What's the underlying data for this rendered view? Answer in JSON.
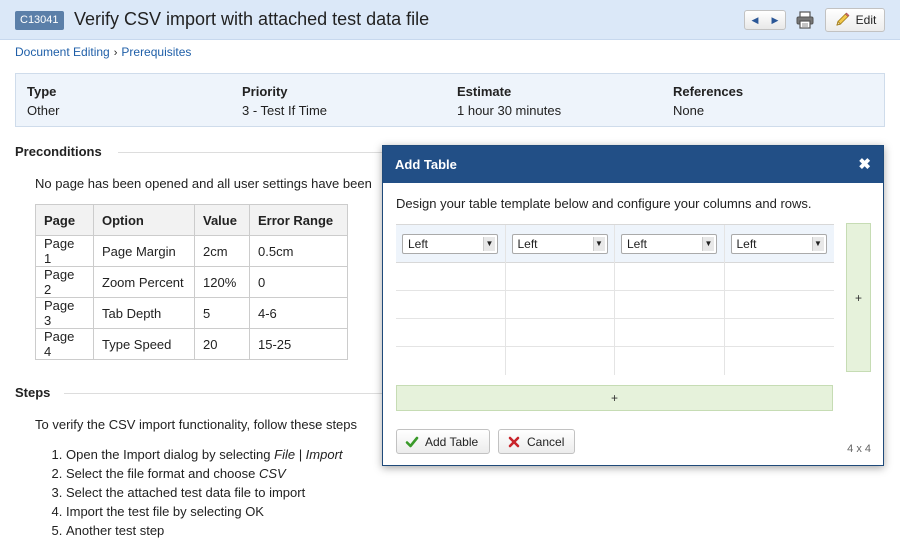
{
  "header": {
    "case_id": "C13041",
    "title": "Verify CSV import with attached test data file",
    "edit_label": "Edit",
    "prev_glyph": "◀",
    "next_glyph": "▶"
  },
  "breadcrumb": {
    "items": [
      "Document Editing",
      "Prerequisites"
    ],
    "separator": "›"
  },
  "info": {
    "fields": [
      {
        "label": "Type",
        "value": "Other"
      },
      {
        "label": "Priority",
        "value": "3 - Test If Time"
      },
      {
        "label": "Estimate",
        "value": "1 hour 30 minutes"
      },
      {
        "label": "References",
        "value": "None"
      }
    ]
  },
  "preconditions": {
    "title": "Preconditions",
    "text": "No page has been opened and all user settings have been",
    "table": {
      "headers": [
        "Page",
        "Option",
        "Value",
        "Error Range"
      ],
      "rows": [
        [
          "Page 1",
          "Page Margin",
          "2cm",
          "0.5cm"
        ],
        [
          "Page 2",
          "Zoom Percent",
          "120%",
          "0"
        ],
        [
          "Page 3",
          "Tab Depth",
          "5",
          "4-6"
        ],
        [
          "Page 4",
          "Type Speed",
          "20",
          "15-25"
        ]
      ]
    }
  },
  "steps": {
    "title": "Steps",
    "intro": "To verify the CSV import functionality, follow these steps",
    "items": [
      {
        "text": "Open the Import dialog by selecting ",
        "em": "File | Import"
      },
      {
        "text": "Select the file format and choose ",
        "em": "CSV"
      },
      {
        "text": "Select the attached test data file to import",
        "em": ""
      },
      {
        "text": "Import the test file by selecting OK",
        "em": ""
      },
      {
        "text": "Another test step",
        "em": ""
      }
    ]
  },
  "dialog": {
    "title": "Add Table",
    "close_glyph": "✖",
    "description": "Design your table template below and configure your columns and rows.",
    "columns": [
      {
        "align": "Left"
      },
      {
        "align": "Left"
      },
      {
        "align": "Left"
      },
      {
        "align": "Left"
      }
    ],
    "add_column_label": "+",
    "add_row_label": "+",
    "add_table_label": "Add Table",
    "cancel_label": "Cancel",
    "dimensions": "4 x 4"
  },
  "colors": {
    "header_bg": "#dbe8f8",
    "dialog_header": "#224f86",
    "link": "#1f5fa8",
    "add_btn_bg": "#e6f2db",
    "check_green": "#3a9a2a",
    "cancel_red": "#c8242b"
  }
}
